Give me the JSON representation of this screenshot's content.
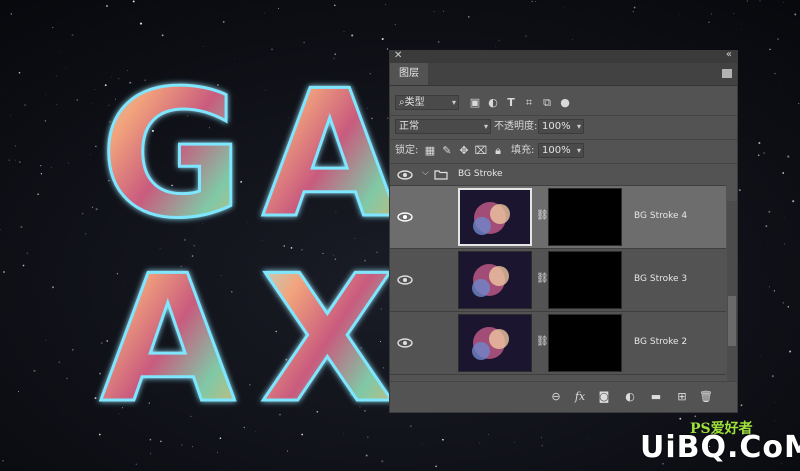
{
  "window": {
    "close_label": "✕",
    "collapse_label": "«"
  },
  "panel": {
    "tab_label": "图层",
    "kind_filter": {
      "icon": "search-icon",
      "label": "类型"
    },
    "blend_mode": "正常",
    "opacity": {
      "label": "不透明度:",
      "value": "100%"
    },
    "lock_label": "锁定:",
    "fill": {
      "label": "填充:",
      "value": "100%"
    }
  },
  "layers": {
    "group_name": "BG Stroke",
    "items": [
      {
        "name": "BG Stroke 4",
        "selected": true
      },
      {
        "name": "BG Stroke 3",
        "selected": false
      },
      {
        "name": "BG Stroke 2",
        "selected": false
      }
    ]
  },
  "artwork": {
    "letters": [
      "G",
      "A",
      "A",
      "X"
    ]
  },
  "watermark": {
    "site_name": "PS爱好者",
    "domain": "UiBQ.CoM"
  },
  "colors": {
    "panel_bg": "#535353",
    "selected_row": "#6d6d6d",
    "accent_glow": "#5fe0ff"
  }
}
